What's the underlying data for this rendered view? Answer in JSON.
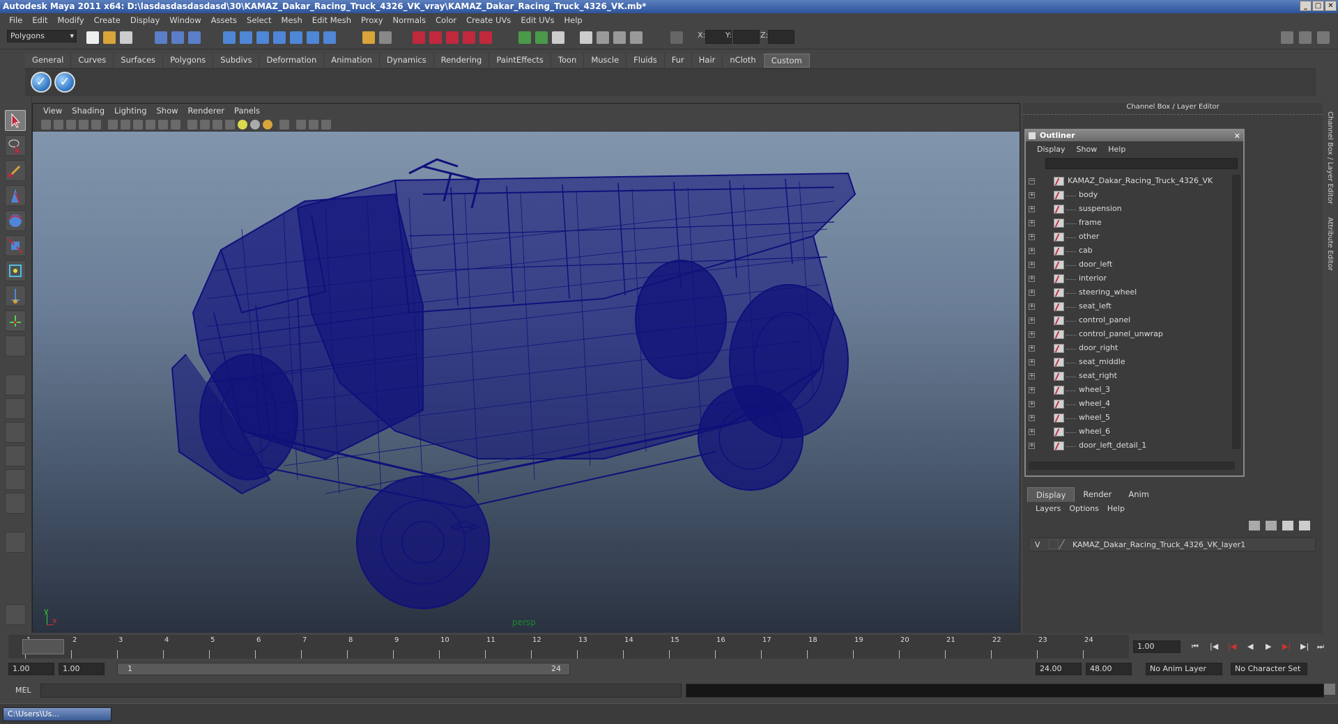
{
  "window": {
    "title": "Autodesk Maya 2011 x64: D:\\lasdasdasdasdasd\\30\\KAMAZ_Dakar_Racing_Truck_4326_VK_vray\\KAMAZ_Dakar_Racing_Truck_4326_VK.mb*"
  },
  "menubar": [
    "File",
    "Edit",
    "Modify",
    "Create",
    "Display",
    "Window",
    "Assets",
    "Select",
    "Mesh",
    "Edit Mesh",
    "Proxy",
    "Normals",
    "Color",
    "Create UVs",
    "Edit UVs",
    "Help"
  ],
  "statusline": {
    "mode": "Polygons",
    "x_label": "X:",
    "y_label": "Y:",
    "z_label": "Z:"
  },
  "shelf": {
    "tabs": [
      "General",
      "Curves",
      "Surfaces",
      "Polygons",
      "Subdivs",
      "Deformation",
      "Animation",
      "Dynamics",
      "Rendering",
      "PaintEffects",
      "Toon",
      "Muscle",
      "Fluids",
      "Fur",
      "Hair",
      "nCloth",
      "Custom"
    ],
    "active_tab": "Custom"
  },
  "viewport": {
    "menu": [
      "View",
      "Shading",
      "Lighting",
      "Show",
      "Renderer",
      "Panels"
    ],
    "camera_label": "persp",
    "axis_y": "y",
    "axis_x": "x",
    "wire_color": "#10107a"
  },
  "channel_box": {
    "header": "Channel Box / Layer Editor",
    "side_tab_1": "Channel Box / Layer Editor",
    "side_tab_2": "Attribute Editor"
  },
  "outliner": {
    "title": "Outliner",
    "menu": [
      "Display",
      "Show",
      "Help"
    ],
    "root": "KAMAZ_Dakar_Racing_Truck_4326_VK",
    "items": [
      "body",
      "suspension",
      "frame",
      "other",
      "cab",
      "door_left",
      "interior",
      "steering_wheel",
      "seat_left",
      "control_panel",
      "control_panel_unwrap",
      "door_right",
      "seat_middle",
      "seat_right",
      "wheel_3",
      "wheel_4",
      "wheel_5",
      "wheel_6",
      "door_left_detail_1"
    ]
  },
  "layer_editor": {
    "tabs": [
      "Display",
      "Render",
      "Anim"
    ],
    "active_tab": "Display",
    "menu": [
      "Layers",
      "Options",
      "Help"
    ],
    "layer_visibility": "V",
    "layer_name": "KAMAZ_Dakar_Racing_Truck_4326_VK_layer1"
  },
  "timeline": {
    "ticks": [
      "1",
      "2",
      "3",
      "4",
      "5",
      "6",
      "7",
      "8",
      "9",
      "10",
      "11",
      "12",
      "13",
      "14",
      "15",
      "16",
      "17",
      "18",
      "19",
      "20",
      "21",
      "22",
      "23",
      "24"
    ],
    "current_frame": "1.00"
  },
  "range": {
    "start_time": "1.00",
    "playback_start": "1.00",
    "range_start": "1",
    "range_end": "24",
    "playback_end": "24.00",
    "end_time": "48.00",
    "anim_layer": "No Anim Layer",
    "character_set": "No Character Set"
  },
  "cmdline": {
    "label": "MEL"
  },
  "taskbar": {
    "item": "C:\\Users\\Us..."
  }
}
